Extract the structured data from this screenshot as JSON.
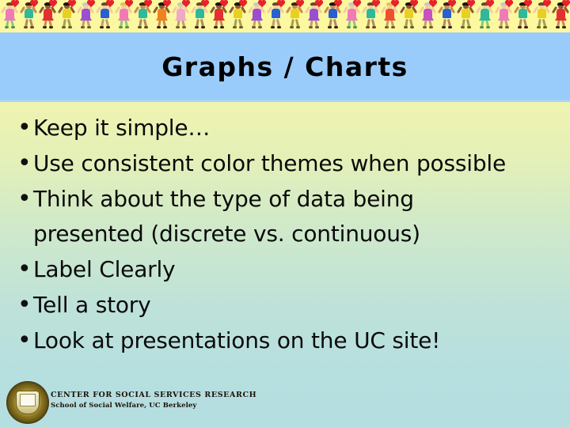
{
  "slide": {
    "title": "Graphs / Charts",
    "background_top_color": "#F8F8A8",
    "background_bottom_color": "#B5DEE1",
    "title_band_color": "#99CCFB",
    "border_strip_color": "#FBF8A0"
  },
  "bullets": [
    {
      "marker": "•",
      "text": "Keep it simple…"
    },
    {
      "marker": "•",
      "text": "Use consistent color themes when possible"
    },
    {
      "marker": "•",
      "text": "Think about the type of data being\npresented (discrete vs. continuous)"
    },
    {
      "marker": "•",
      "text": "Label Clearly"
    },
    {
      "marker": "•",
      "text": "Tell a story"
    },
    {
      "marker": "•",
      "text": "Look at presentations on the UC site!"
    }
  ],
  "footer": {
    "organization": "CENTER FOR SOCIAL SERVICES RESEARCH",
    "school": "School of Social Welfare, UC Berkeley",
    "seal_icon": "uc-berkeley-seal-icon"
  },
  "decorative_border": {
    "icon": "dancing-figure-icon",
    "count": 30,
    "figures": [
      {
        "dress": "#F07AB8",
        "skin": "#F3CBA0",
        "hair": "#6B4A22",
        "legs": "#8FC87A",
        "shoes": "#5A8F4A",
        "heart": true,
        "style": "dress"
      },
      {
        "dress": "#2FB89A",
        "skin": "#C98A52",
        "hair": "#3A2410",
        "legs": "#B08A60",
        "shoes": "#6B4A22",
        "heart": true,
        "style": "shirt"
      },
      {
        "dress": "#E23030",
        "skin": "#8A5A34",
        "hair": "#1A1008",
        "legs": "#C98A52",
        "shoes": "#3A2410",
        "heart": true,
        "style": "dress"
      },
      {
        "dress": "#E8D020",
        "skin": "#8A5A34",
        "hair": "#1A1008",
        "legs": "#A8A050",
        "shoes": "#6B6020",
        "heart": true,
        "style": "shirt"
      },
      {
        "dress": "#9B4FD0",
        "skin": "#F3CBA0",
        "hair": "#C8C8C8",
        "legs": "#C0A070",
        "shoes": "#7A5A30",
        "heart": true,
        "style": "dress"
      },
      {
        "dress": "#2A5FD0",
        "skin": "#F3CBA0",
        "hair": "#6B4A22",
        "legs": "#C0A070",
        "shoes": "#3A2410",
        "heart": true,
        "style": "shirt"
      },
      {
        "dress": "#F07AB8",
        "skin": "#F3CBA0",
        "hair": "#E8C050",
        "legs": "#8FC87A",
        "shoes": "#5A8F4A",
        "heart": true,
        "style": "dress"
      },
      {
        "dress": "#2FB89A",
        "skin": "#C98A52",
        "hair": "#3A2410",
        "legs": "#B08A60",
        "shoes": "#6B4A22",
        "heart": true,
        "style": "shirt"
      },
      {
        "dress": "#F08020",
        "skin": "#8A5A34",
        "hair": "#1A1008",
        "legs": "#C98A52",
        "shoes": "#3A2410",
        "heart": true,
        "style": "dress"
      },
      {
        "dress": "#F0A8C8",
        "skin": "#F3CBA0",
        "hair": "#C8C8C8",
        "legs": "#C0A070",
        "shoes": "#7A5A30",
        "heart": true,
        "style": "dress"
      },
      {
        "dress": "#2FB89A",
        "skin": "#F3CBA0",
        "hair": "#6B4A22",
        "legs": "#B08A60",
        "shoes": "#3A2410",
        "heart": true,
        "style": "shirt"
      },
      {
        "dress": "#E23030",
        "skin": "#8A5A34",
        "hair": "#1A1008",
        "legs": "#C98A52",
        "shoes": "#3A2410",
        "heart": true,
        "style": "dress"
      },
      {
        "dress": "#E8D020",
        "skin": "#8A5A34",
        "hair": "#1A1008",
        "legs": "#A8A050",
        "shoes": "#6B6020",
        "heart": true,
        "style": "shirt"
      },
      {
        "dress": "#9B4FD0",
        "skin": "#F3CBA0",
        "hair": "#C8C8C8",
        "legs": "#C0A070",
        "shoes": "#7A5A30",
        "heart": true,
        "style": "dress"
      },
      {
        "dress": "#2A5FD0",
        "skin": "#F3CBA0",
        "hair": "#6B4A22",
        "legs": "#C0A070",
        "shoes": "#3A2410",
        "heart": true,
        "style": "shirt"
      },
      {
        "dress": "#E8D020",
        "skin": "#C98A52",
        "hair": "#3A2410",
        "legs": "#A8A050",
        "shoes": "#6B6020",
        "heart": true,
        "style": "shirt"
      },
      {
        "dress": "#9B4FD0",
        "skin": "#F3CBA0",
        "hair": "#6B4A22",
        "legs": "#C0A070",
        "shoes": "#7A5A30",
        "heart": true,
        "style": "dress"
      },
      {
        "dress": "#2A5FD0",
        "skin": "#C98A52",
        "hair": "#1A1008",
        "legs": "#B08A60",
        "shoes": "#3A2410",
        "heart": true,
        "style": "shirt"
      },
      {
        "dress": "#F07AB8",
        "skin": "#F3CBA0",
        "hair": "#C8C8C8",
        "legs": "#8FC87A",
        "shoes": "#5A8F4A",
        "heart": true,
        "style": "dress"
      },
      {
        "dress": "#2FB89A",
        "skin": "#F3CBA0",
        "hair": "#6B4A22",
        "legs": "#B08A60",
        "shoes": "#6B4A22",
        "heart": true,
        "style": "shirt"
      },
      {
        "dress": "#F05030",
        "skin": "#F3CBA0",
        "hair": "#E8C050",
        "legs": "#C0A070",
        "shoes": "#7A5A30",
        "heart": true,
        "style": "dress"
      },
      {
        "dress": "#E8D020",
        "skin": "#8A5A34",
        "hair": "#1A1008",
        "legs": "#A8A050",
        "shoes": "#6B6020",
        "heart": true,
        "style": "shirt"
      },
      {
        "dress": "#C850C0",
        "skin": "#F3CBA0",
        "hair": "#C8C8C8",
        "legs": "#C0A070",
        "shoes": "#7A5A30",
        "heart": true,
        "style": "dress"
      },
      {
        "dress": "#2A5FD0",
        "skin": "#C98A52",
        "hair": "#3A2410",
        "legs": "#B08A60",
        "shoes": "#3A2410",
        "heart": true,
        "style": "shirt"
      },
      {
        "dress": "#E8D020",
        "skin": "#8A5A34",
        "hair": "#1A1008",
        "legs": "#A8A050",
        "shoes": "#6B6020",
        "heart": true,
        "style": "shirt"
      },
      {
        "dress": "#2FB89A",
        "skin": "#F3CBA0",
        "hair": "#6B4A22",
        "legs": "#8FC87A",
        "shoes": "#5A8F4A",
        "heart": true,
        "style": "dress"
      },
      {
        "dress": "#F07AB8",
        "skin": "#F3CBA0",
        "hair": "#C8C8C8",
        "legs": "#C0A070",
        "shoes": "#7A5A30",
        "heart": true,
        "style": "dress"
      },
      {
        "dress": "#2FB89A",
        "skin": "#C98A52",
        "hair": "#1A1008",
        "legs": "#B08A60",
        "shoes": "#3A2410",
        "heart": true,
        "style": "shirt"
      },
      {
        "dress": "#E8D020",
        "skin": "#F3CBA0",
        "hair": "#6B4A22",
        "legs": "#A8A050",
        "shoes": "#6B6020",
        "heart": true,
        "style": "shirt"
      },
      {
        "dress": "#E23030",
        "skin": "#8A5A34",
        "hair": "#1A1008",
        "legs": "#C98A52",
        "shoes": "#3A2410",
        "heart": true,
        "style": "dress"
      }
    ]
  }
}
